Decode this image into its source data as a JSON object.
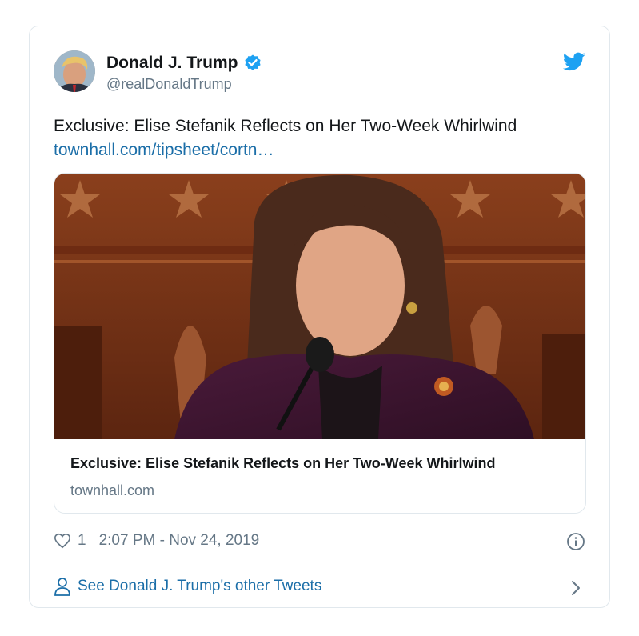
{
  "author": {
    "name": "Donald J. Trump",
    "handle": "@realDonaldTrump"
  },
  "tweet": {
    "text": "Exclusive: Elise Stefanik Reflects on Her Two-Week Whirlwind",
    "link": "townhall.com/tipsheet/cortn…"
  },
  "link_card": {
    "title": "Exclusive: Elise Stefanik Reflects on Her Two-Week Whirlwind",
    "domain": "townhall.com"
  },
  "meta": {
    "likes": "1",
    "timestamp": "2:07 PM - Nov 24, 2019"
  },
  "footer": {
    "label": "See Donald J. Trump's other Tweets"
  },
  "icons": {
    "verified": "verified-badge-icon",
    "bird": "twitter-bird-icon",
    "heart": "heart-icon",
    "info": "info-icon",
    "person": "person-icon",
    "chevron": "chevron-right-icon"
  },
  "colors": {
    "accent": "#1da1f2",
    "link": "#1b6ea8",
    "muted": "#657786",
    "border": "#e1e8ed"
  }
}
